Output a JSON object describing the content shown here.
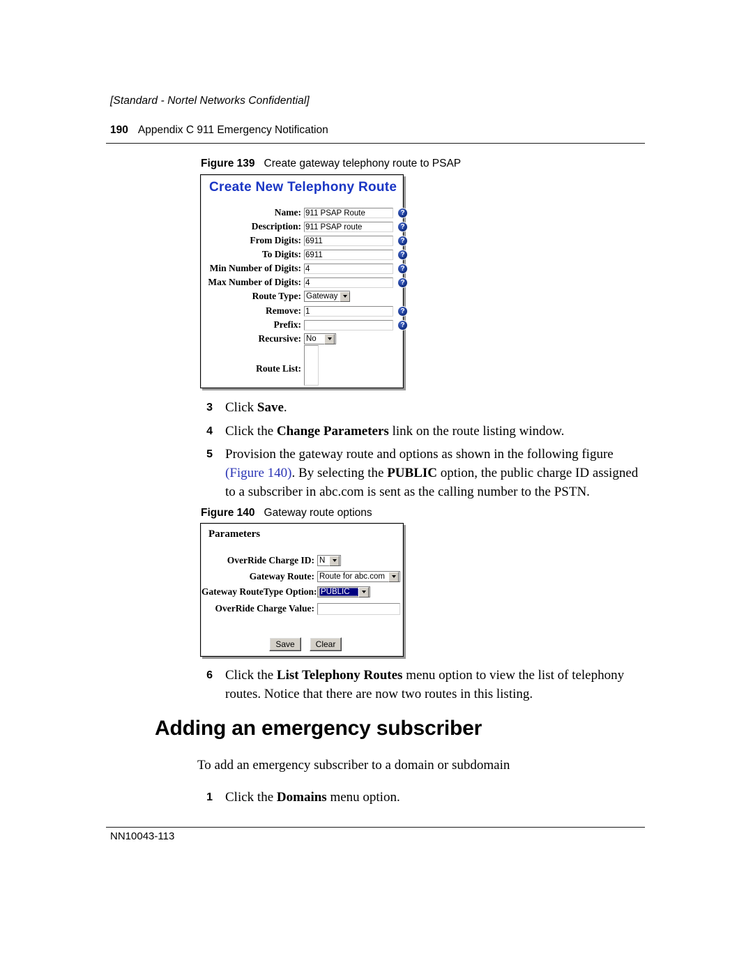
{
  "header": {
    "confidential": "[Standard - Nortel Networks Confidential]",
    "page_number": "190",
    "running_head": "Appendix C  911 Emergency Notification"
  },
  "footer": {
    "doc_id": "NN10043-113"
  },
  "figure_139": {
    "caption_label": "Figure 139",
    "caption_text": "Create gateway telephony route to PSAP",
    "dialog": {
      "title": "Create New Telephony Route",
      "fields": [
        {
          "label": "Name:",
          "value": "911 PSAP Route",
          "type": "text",
          "help": "?"
        },
        {
          "label": "Description:",
          "value": "911 PSAP route",
          "type": "text",
          "help": "?"
        },
        {
          "label": "From Digits:",
          "value": "6911",
          "type": "text",
          "help": "?"
        },
        {
          "label": "To Digits:",
          "value": "6911",
          "type": "text",
          "help": "?"
        },
        {
          "label": "Min Number of Digits:",
          "value": "4",
          "type": "text",
          "help": "?"
        },
        {
          "label": "Max Number of Digits:",
          "value": "4",
          "type": "text",
          "help": "?"
        },
        {
          "label": "Route Type:",
          "value": "Gateway",
          "type": "select"
        },
        {
          "label": "Remove:",
          "value": "1",
          "type": "text",
          "help": "?"
        },
        {
          "label": "Prefix:",
          "value": "",
          "type": "text",
          "help": "?"
        },
        {
          "label": "Recursive:",
          "value": "No",
          "type": "select"
        },
        {
          "label": "Route List:",
          "value": "",
          "type": "listbox"
        }
      ]
    }
  },
  "figure_140": {
    "caption_label": "Figure 140",
    "caption_text": "Gateway route options",
    "dialog": {
      "title": "Parameters",
      "fields": [
        {
          "label": "OverRide Charge ID:",
          "value": "N",
          "type": "select"
        },
        {
          "label": "Gateway Route:",
          "value": "Route for abc.com",
          "type": "select"
        },
        {
          "label": "Gateway RouteType Option:",
          "value": "PUBLIC",
          "type": "select-highlight"
        },
        {
          "label": "OverRide Charge Value:",
          "value": "",
          "type": "text"
        }
      ],
      "buttons": {
        "save": "Save",
        "clear": "Clear"
      }
    }
  },
  "steps": {
    "s3": {
      "num": "3",
      "pre": "Click ",
      "bold": "Save",
      "post": "."
    },
    "s4": {
      "num": "4",
      "pre": "Click the ",
      "bold": "Change Parameters",
      "post": " link on the route listing window."
    },
    "s5": {
      "num": "5",
      "line1": "Provision the gateway route and options as shown in the following figure",
      "xref": "(Figure 140)",
      "line2a": ". By selecting the ",
      "bold": "PUBLIC",
      "line2b": " option, the public charge ID assigned",
      "line3": "to a subscriber in abc.com is sent as the calling number to the PSTN."
    },
    "s6": {
      "num": "6",
      "pre": "Click the ",
      "bold": "List Telephony Routes",
      "post": " menu option to view the list of telephony",
      "line2": "routes. Notice that there are now two routes in this listing."
    },
    "s1b": {
      "num": "1",
      "pre": "Click the ",
      "bold": "Domains",
      "post": " menu option."
    }
  },
  "section": {
    "heading": "Adding an emergency subscriber"
  },
  "body": {
    "intro": "To add an emergency subscriber to a domain or subdomain"
  },
  "colors": {
    "link": "#2b35b5",
    "dialog_title": "#1a36c4",
    "selection": "#000080"
  }
}
